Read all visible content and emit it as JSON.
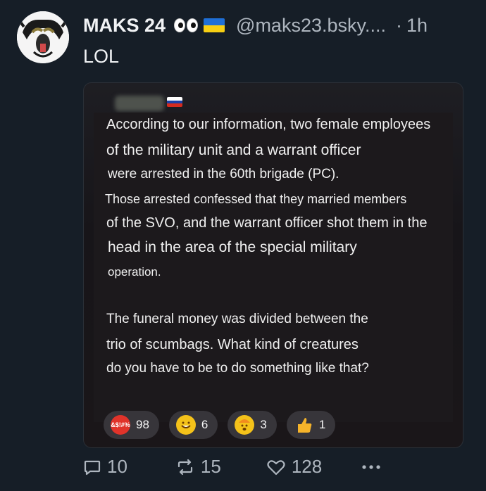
{
  "post": {
    "display_name": "MAKS 24",
    "handle": "@maks23.bsky....",
    "separator": "·",
    "time": "1h",
    "text": "LOL"
  },
  "embed": {
    "lines": [
      "According to our information, two female employees",
      "of the military unit and a warrant officer",
      "were arrested in the 60th brigade (PC).",
      "Those arrested confessed that they married members",
      "of the SVO, and the warrant officer shot them in the",
      "head in the area of the special military",
      "operation.",
      "The funeral money was divided between the",
      "trio of scumbags. What kind of creatures",
      "do you have to be to do something like that?"
    ],
    "reactions": [
      {
        "emoji": "cursing-face-icon",
        "text": "&$!#%",
        "count": "98",
        "color": "#e0332a"
      },
      {
        "emoji": "rofl-face-icon",
        "text": "",
        "count": "6",
        "color": "#f4c21a"
      },
      {
        "emoji": "exploding-head-icon",
        "text": "",
        "count": "3",
        "color": "#f4c21a"
      },
      {
        "emoji": "thumbs-up-icon",
        "text": "",
        "count": "1",
        "color": "#f6b42a"
      }
    ]
  },
  "actions": {
    "replies": "10",
    "reposts": "15",
    "likes": "128"
  },
  "colors": {
    "background": "#161e27",
    "muted": "#aeb6bf"
  }
}
